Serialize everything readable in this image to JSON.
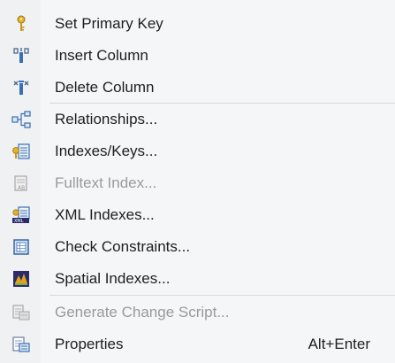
{
  "menu": {
    "items": [
      {
        "label": "Set Primary Key",
        "icon": "key-icon",
        "enabled": true
      },
      {
        "label": "Insert Column",
        "icon": "insert-column-icon",
        "enabled": true
      },
      {
        "label": "Delete Column",
        "icon": "delete-column-icon",
        "enabled": true
      },
      {
        "label": "Relationships...",
        "icon": "relationships-icon",
        "enabled": true
      },
      {
        "label": "Indexes/Keys...",
        "icon": "indexes-keys-icon",
        "enabled": true
      },
      {
        "label": "Fulltext Index...",
        "icon": "fulltext-index-icon",
        "enabled": false
      },
      {
        "label": "XML Indexes...",
        "icon": "xml-indexes-icon",
        "enabled": true
      },
      {
        "label": "Check Constraints...",
        "icon": "check-constraints-icon",
        "enabled": true
      },
      {
        "label": "Spatial Indexes...",
        "icon": "spatial-indexes-icon",
        "enabled": true
      },
      {
        "label": "Generate Change Script...",
        "icon": "generate-script-icon",
        "enabled": false
      },
      {
        "label": "Properties",
        "icon": "properties-icon",
        "enabled": true,
        "shortcut": "Alt+Enter"
      }
    ]
  }
}
